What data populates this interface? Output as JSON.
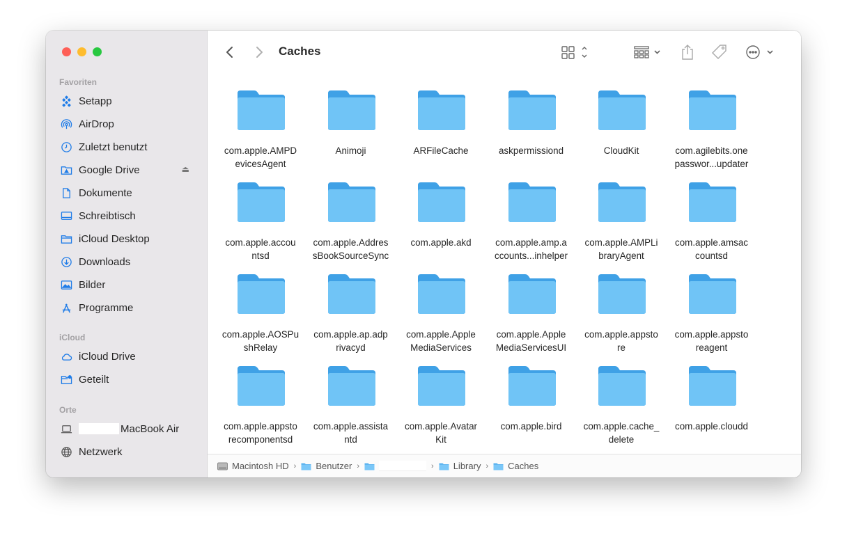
{
  "window": {
    "title": "Caches",
    "traffic_colors": {
      "close": "#fe5f57",
      "minimize": "#febc2e",
      "zoom": "#28c840"
    }
  },
  "sidebar": {
    "favorites_title": "Favoriten",
    "favorites": [
      {
        "label": "Setapp",
        "icon": "setapp-icon"
      },
      {
        "label": "AirDrop",
        "icon": "airdrop-icon"
      },
      {
        "label": "Zuletzt benutzt",
        "icon": "clock-icon"
      },
      {
        "label": "Google Drive",
        "icon": "drive-folder-icon"
      },
      {
        "label": "Dokumente",
        "icon": "document-icon"
      },
      {
        "label": "Schreibtisch",
        "icon": "desktop-icon"
      },
      {
        "label": "iCloud Desktop",
        "icon": "folder-icon"
      },
      {
        "label": "Downloads",
        "icon": "download-icon"
      },
      {
        "label": "Bilder",
        "icon": "photo-icon"
      },
      {
        "label": "Programme",
        "icon": "apps-icon"
      }
    ],
    "icloud_title": "iCloud",
    "icloud": [
      {
        "label": "iCloud Drive",
        "icon": "cloud-icon"
      },
      {
        "label": "Geteilt",
        "icon": "shared-folder-icon"
      }
    ],
    "places_title": "Orte",
    "places": [
      {
        "label": "MacBook Air",
        "icon": "laptop-icon"
      },
      {
        "label": "Netzwerk",
        "icon": "network-icon"
      }
    ]
  },
  "folders": [
    "com.apple.AMPDevicesAgent",
    "Animoji",
    "ARFileCache",
    "askpermissiond",
    "CloudKit",
    "com.agilebits.onepasswor...updater",
    "com.apple.accountsd",
    "com.apple.AddressBookSourceSync",
    "com.apple.akd",
    "com.apple.amp.accounts...inhelper",
    "com.apple.AMPLibraryAgent",
    "com.apple.amsaccountsd",
    "com.apple.AOSPushRelay",
    "com.apple.ap.adprivacyd",
    "com.apple.AppleMediaServices",
    "com.apple.AppleMediaServicesUI",
    "com.apple.appstore",
    "com.apple.appstoreagent",
    "com.apple.appstorecomponentsd",
    "com.apple.assistantd",
    "com.apple.AvatarKit",
    "com.apple.bird",
    "com.apple.cache_delete",
    "com.apple.cloudd"
  ],
  "folder_lines": [
    [
      "com.apple.AMPD",
      "evicesAgent"
    ],
    [
      "Animoji"
    ],
    [
      "ARFileCache"
    ],
    [
      "askpermissiond"
    ],
    [
      "CloudKit"
    ],
    [
      "com.agilebits.one",
      "passwor...updater"
    ],
    [
      "com.apple.accou",
      "ntsd"
    ],
    [
      "com.apple.Addres",
      "sBookSourceSync"
    ],
    [
      "com.apple.akd"
    ],
    [
      "com.apple.amp.a",
      "ccounts...inhelper"
    ],
    [
      "com.apple.AMPLi",
      "braryAgent"
    ],
    [
      "com.apple.amsac",
      "countsd"
    ],
    [
      "com.apple.AOSPu",
      "shRelay"
    ],
    [
      "com.apple.ap.adp",
      "rivacyd"
    ],
    [
      "com.apple.Apple",
      "MediaServices"
    ],
    [
      "com.apple.Apple",
      "MediaServicesUI"
    ],
    [
      "com.apple.appsto",
      "re"
    ],
    [
      "com.apple.appsto",
      "reagent"
    ],
    [
      "com.apple.appsto",
      "recomponentsd"
    ],
    [
      "com.apple.assista",
      "ntd"
    ],
    [
      "com.apple.Avatar",
      "Kit"
    ],
    [
      "com.apple.bird"
    ],
    [
      "com.apple.cache_",
      "delete"
    ],
    [
      "com.apple.cloudd"
    ]
  ],
  "pathbar": [
    "Macintosh HD",
    "Benutzer",
    "",
    "Library",
    "Caches"
  ],
  "colors": {
    "folder_top": "#3fa1e6",
    "folder_body": "#70c4f6",
    "accent": "#1f7ce8"
  }
}
